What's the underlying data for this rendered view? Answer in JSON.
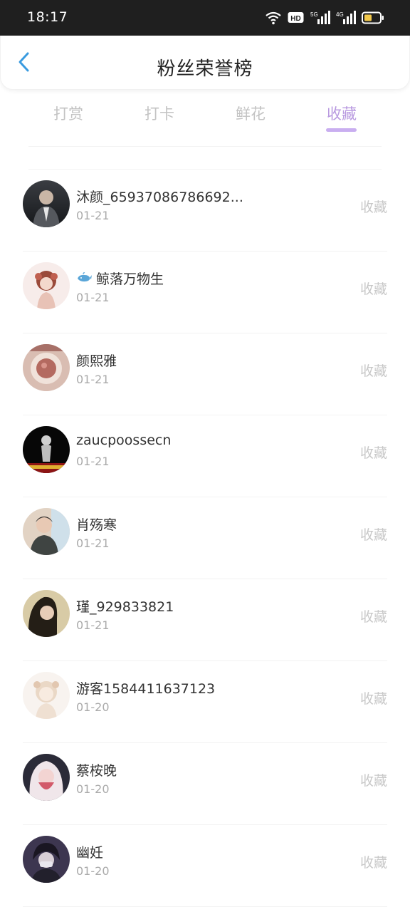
{
  "status_bar": {
    "time": "18:17",
    "icons": [
      "wifi-icon",
      "hd-icon",
      "signal-5g-icon",
      "signal-4g-icon",
      "battery-icon"
    ],
    "hd_label": "HD",
    "net1": "5G",
    "net2": "4G"
  },
  "header": {
    "title": "粉丝荣誉榜",
    "back_icon": "chevron-left-icon",
    "accent": "#3a9be0"
  },
  "tabs": [
    {
      "label": "打赏",
      "active": false
    },
    {
      "label": "打卡",
      "active": false
    },
    {
      "label": "鲜花",
      "active": false
    },
    {
      "label": "收藏",
      "active": true
    }
  ],
  "tab_accent": "#b99ae0",
  "list": [
    {
      "name": "沐颜_65937086786692...",
      "date": "01-21",
      "action": "收藏",
      "avatar": [
        "#2b2e33",
        "#6b6e73"
      ]
    },
    {
      "name": "鲸落万物生",
      "prefix_icon": "whale-icon",
      "date": "01-21",
      "action": "收藏",
      "avatar": [
        "#f5e6e4",
        "#c7756a"
      ]
    },
    {
      "name": "颜熙雅",
      "date": "01-21",
      "action": "收藏",
      "avatar": [
        "#e9cfc5",
        "#8a5a55"
      ]
    },
    {
      "name": "zaucpoossecn",
      "date": "01-21",
      "action": "收藏",
      "avatar": [
        "#0a0a0a",
        "#b02020"
      ]
    },
    {
      "name": "肖殇寒",
      "date": "01-21",
      "action": "收藏",
      "avatar": [
        "#d8c7b6",
        "#4a4d4a"
      ]
    },
    {
      "name": "瑾_929833821",
      "date": "01-21",
      "action": "收藏",
      "avatar": [
        "#3a3224",
        "#d4c6a1"
      ]
    },
    {
      "name": "游客1584411637123",
      "date": "01-20",
      "action": "收藏",
      "avatar": [
        "#f4ece6",
        "#d9bfa7"
      ]
    },
    {
      "name": "蔡桉晚",
      "date": "01-20",
      "action": "收藏",
      "avatar": [
        "#2a2b3a",
        "#e6a9b0"
      ]
    },
    {
      "name": "幽妊",
      "date": "01-20",
      "action": "收藏",
      "avatar": [
        "#3b3450",
        "#a8a4b8"
      ]
    }
  ]
}
